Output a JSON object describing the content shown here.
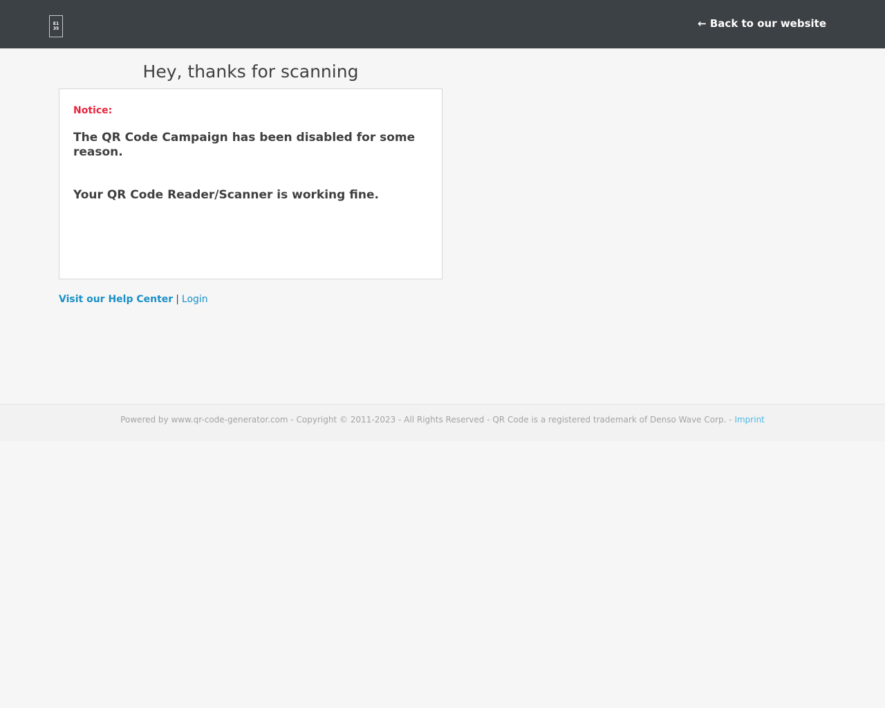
{
  "header": {
    "logo_lines": [
      "E1",
      "35"
    ],
    "back_link": "← Back to our website"
  },
  "main": {
    "heading": "Hey, thanks for scanning",
    "notice_label": "Notice:",
    "message_disabled": "The QR Code Campaign has been disabled for some reason.",
    "message_scanner": "Your QR Code Reader/Scanner is working fine."
  },
  "links": {
    "help_center": "Visit our Help Center",
    "separator": "|",
    "login": "Login"
  },
  "footer": {
    "text": "Powered by www.qr-code-generator.com - Copyright © 2011-2023 - All Rights Reserved - QR Code is a registered trademark of Denso Wave Corp. -",
    "imprint": "Imprint"
  },
  "colors": {
    "topbar": "#3c4146",
    "page_background": "#f6f6f6",
    "notice": "#e8243c",
    "link": "#1a8fc7",
    "imprint_link": "#4fb7e3"
  }
}
